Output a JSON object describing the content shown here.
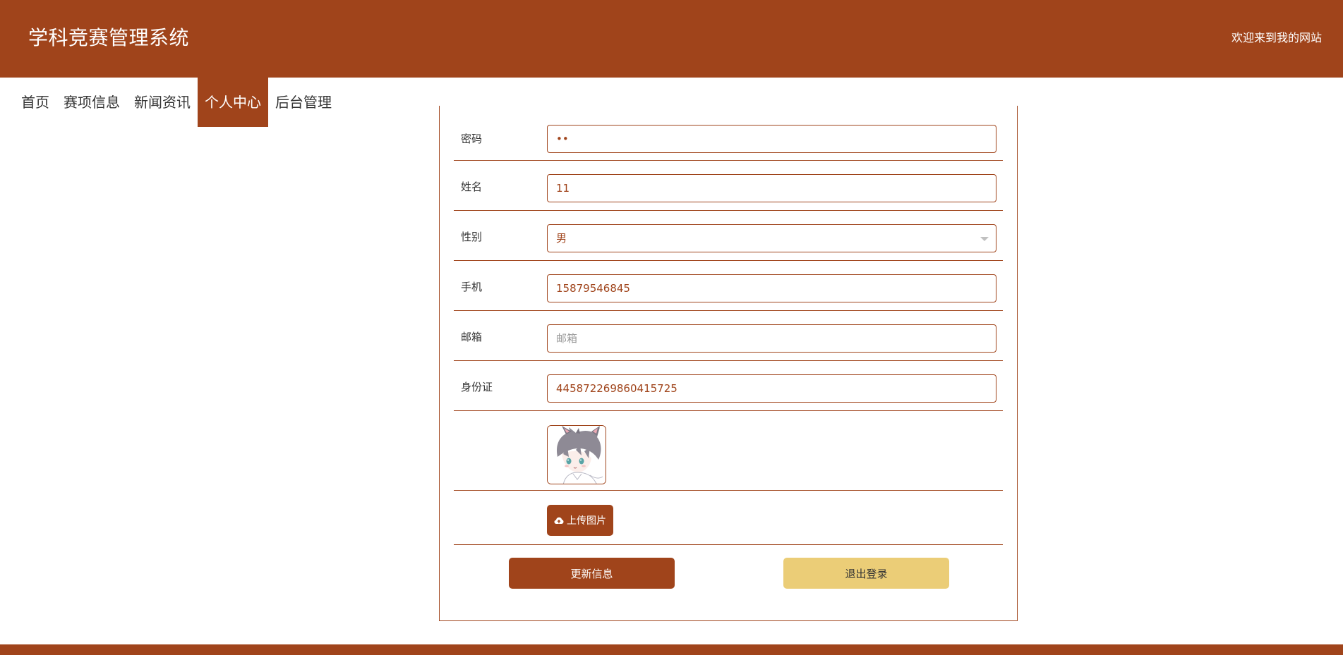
{
  "header": {
    "title": "学科竞赛管理系统",
    "welcome": "欢迎来到我的网站"
  },
  "nav": {
    "items": [
      {
        "label": "首页"
      },
      {
        "label": "赛项信息"
      },
      {
        "label": "新闻资讯"
      },
      {
        "label": "个人中心",
        "active": true
      },
      {
        "label": "后台管理"
      }
    ]
  },
  "form": {
    "password": {
      "label": "密码",
      "value": "••"
    },
    "name": {
      "label": "姓名",
      "value": "11"
    },
    "gender": {
      "label": "性别",
      "value": "男"
    },
    "phone": {
      "label": "手机",
      "value": "15879546845"
    },
    "email": {
      "label": "邮箱",
      "value": "",
      "placeholder": "邮箱"
    },
    "idcard": {
      "label": "身份证",
      "value": "445872269860415725"
    },
    "upload_label": "上传图片"
  },
  "actions": {
    "update_label": "更新信息",
    "logout_label": "退出登录"
  },
  "colors": {
    "brand": "#a0441b",
    "logout_button": "#ebcd77"
  },
  "icons": {
    "upload": "cloud-upload-icon",
    "select": "caret-down-icon"
  }
}
